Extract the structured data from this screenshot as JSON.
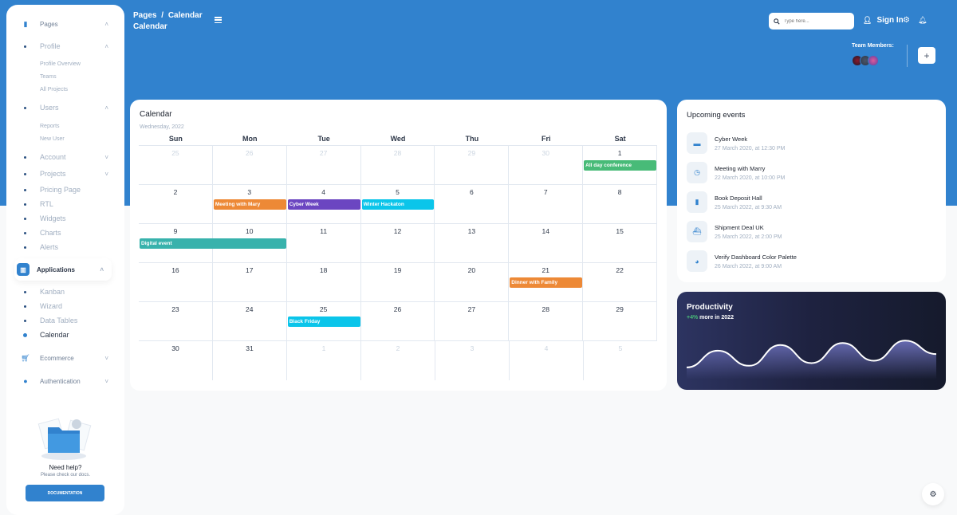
{
  "sidebar": {
    "pages": {
      "label": "Pages",
      "icon": "document-icon"
    },
    "profile": {
      "label": "Profile",
      "sub": [
        "Profile Overview",
        "Teams",
        "All Projects"
      ]
    },
    "users": {
      "label": "Users",
      "sub": [
        "Reports",
        "New User"
      ]
    },
    "items": [
      "Account",
      "Projects",
      "Pricing Page",
      "RTL",
      "Widgets",
      "Charts",
      "Alerts"
    ],
    "applications": {
      "label": "Applications",
      "icon": "chart-bar-icon"
    },
    "apps_items": [
      "Kanban",
      "Wizard",
      "Data Tables",
      "Calendar"
    ],
    "active_item": "Calendar",
    "ecommerce": {
      "label": "Ecommerce",
      "icon": "cart-icon"
    },
    "authentication": {
      "label": "Authentication",
      "icon": "person-icon"
    },
    "help": {
      "title": "Need help?",
      "subtitle": "Please check our docs.",
      "button": "DOCUMENTATION"
    }
  },
  "header": {
    "breadcrumb_root": "Pages",
    "breadcrumb_sep": "/",
    "breadcrumb_current": "Calendar",
    "title": "Calendar",
    "search_placeholder": "Type here...",
    "sign_in": "Sign In",
    "team_label": "Team Members:",
    "add_label": "+"
  },
  "calendar": {
    "title": "Calendar",
    "subtitle": "Wednesday, 2022",
    "weekdays": [
      "Sun",
      "Mon",
      "Tue",
      "Wed",
      "Thu",
      "Fri",
      "Sat"
    ],
    "weeks": [
      [
        {
          "d": "25",
          "o": true
        },
        {
          "d": "26",
          "o": true
        },
        {
          "d": "27",
          "o": true
        },
        {
          "d": "28",
          "o": true
        },
        {
          "d": "29",
          "o": true
        },
        {
          "d": "30",
          "o": true
        },
        {
          "d": "1",
          "o": false
        }
      ],
      [
        {
          "d": "2",
          "o": false
        },
        {
          "d": "3",
          "o": false
        },
        {
          "d": "4",
          "o": false
        },
        {
          "d": "5",
          "o": false
        },
        {
          "d": "6",
          "o": false
        },
        {
          "d": "7",
          "o": false
        },
        {
          "d": "8",
          "o": false
        }
      ],
      [
        {
          "d": "9",
          "o": false
        },
        {
          "d": "10",
          "o": false
        },
        {
          "d": "11",
          "o": false
        },
        {
          "d": "12",
          "o": false
        },
        {
          "d": "13",
          "o": false
        },
        {
          "d": "14",
          "o": false
        },
        {
          "d": "15",
          "o": false
        }
      ],
      [
        {
          "d": "16",
          "o": false
        },
        {
          "d": "17",
          "o": false
        },
        {
          "d": "18",
          "o": false
        },
        {
          "d": "19",
          "o": false
        },
        {
          "d": "20",
          "o": false
        },
        {
          "d": "21",
          "o": false
        },
        {
          "d": "22",
          "o": false
        }
      ],
      [
        {
          "d": "23",
          "o": false
        },
        {
          "d": "24",
          "o": false
        },
        {
          "d": "25",
          "o": false
        },
        {
          "d": "26",
          "o": false
        },
        {
          "d": "27",
          "o": false
        },
        {
          "d": "28",
          "o": false
        },
        {
          "d": "29",
          "o": false
        }
      ],
      [
        {
          "d": "30",
          "o": false
        },
        {
          "d": "31",
          "o": false
        },
        {
          "d": "1",
          "o": true
        },
        {
          "d": "2",
          "o": true
        },
        {
          "d": "3",
          "o": true
        },
        {
          "d": "4",
          "o": true
        },
        {
          "d": "5",
          "o": true
        }
      ]
    ],
    "events": [
      {
        "title": "All day conference",
        "week": 0,
        "start_day": 6,
        "span_days": 1,
        "color": "#48bb78"
      },
      {
        "title": "Meeting with Mary",
        "week": 1,
        "start_day": 1,
        "span_days": 1,
        "color": "#ed8936"
      },
      {
        "title": "Cyber Week",
        "week": 1,
        "start_day": 2,
        "span_days": 1,
        "color": "#6b46c1"
      },
      {
        "title": "Winter Hackaton",
        "week": 1,
        "start_day": 3,
        "span_days": 1,
        "color": "#0bc5ea"
      },
      {
        "title": "Digital event",
        "week": 2,
        "start_day": 0,
        "span_days": 2,
        "color": "#38b2ac"
      },
      {
        "title": "Dinner with Family",
        "week": 3,
        "start_day": 5,
        "span_days": 1,
        "color": "#ed8936"
      },
      {
        "title": "Black Friday",
        "week": 4,
        "start_day": 2,
        "span_days": 1,
        "color": "#0bc5ea"
      }
    ]
  },
  "upcoming": {
    "title": "Upcoming events",
    "items": [
      {
        "name": "Cyber Week",
        "date": "27 March 2020, at 12:30 PM",
        "icon": "wallet-icon",
        "glyph": "▬"
      },
      {
        "name": "Meeting with Marry",
        "date": "22 March 2020, at 10:00 PM",
        "icon": "clock-icon",
        "glyph": "◷"
      },
      {
        "name": "Book Deposit Hall",
        "date": "25 March 2022, at 9:30 AM",
        "icon": "document-icon",
        "glyph": "▮"
      },
      {
        "name": "Shipment Deal UK",
        "date": "25 March 2022, at 2:00 PM",
        "icon": "ship-icon",
        "glyph": "⛴"
      },
      {
        "name": "Verify Dashboard Color Palette",
        "date": "26 March 2022, at 9:00 AM",
        "icon": "palette-icon",
        "glyph": "◕"
      }
    ]
  },
  "productivity": {
    "title": "Productivity",
    "change": "+4%",
    "change_suffix": "more in 2022",
    "chart_data": {
      "type": "area",
      "values": [
        0.05,
        0.55,
        0.1,
        0.72,
        0.18,
        0.78,
        0.25,
        0.85,
        0.45
      ],
      "ylim": [
        0,
        1
      ]
    }
  },
  "colors": {
    "primary": "#3182ce",
    "positive": "#48bb78"
  }
}
